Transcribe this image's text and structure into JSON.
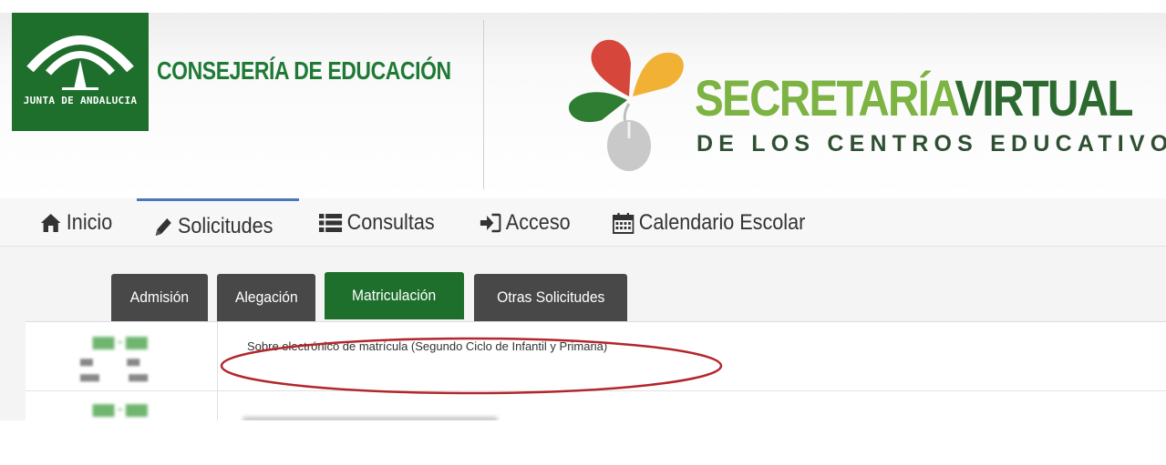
{
  "header": {
    "junta_logo_text": "JUNTA DE ANDALUCIA",
    "consejeria": "CONSEJERÍA DE EDUCACIÓN",
    "sv_title_part1": "SECRETARÍA",
    "sv_title_part2": "VIRTUAL",
    "sv_subtitle": "DE LOS CENTROS EDUCATIVOS"
  },
  "nav": {
    "items": [
      {
        "label": "Inicio",
        "icon": "home-icon"
      },
      {
        "label": "Solicitudes",
        "icon": "pencil-icon",
        "active": true
      },
      {
        "label": "Consultas",
        "icon": "list-icon"
      },
      {
        "label": "Acceso",
        "icon": "sign-in-icon"
      },
      {
        "label": "Calendario Escolar",
        "icon": "calendar-icon"
      }
    ]
  },
  "tabs": [
    {
      "label": "Admisión"
    },
    {
      "label": "Alegación"
    },
    {
      "label": "Matriculación",
      "active": true
    },
    {
      "label": "Otras Solicitudes"
    }
  ],
  "rows": [
    {
      "description": "Sobre electrónico de matrícula (Segundo Ciclo de Infantil y Primaria)"
    }
  ],
  "colors": {
    "brand_green": "#1e6e2c",
    "light_green": "#7cb342",
    "tab_dark": "#484848",
    "nav_accent": "#4a78b5",
    "ellipse_red": "#b3262b"
  }
}
